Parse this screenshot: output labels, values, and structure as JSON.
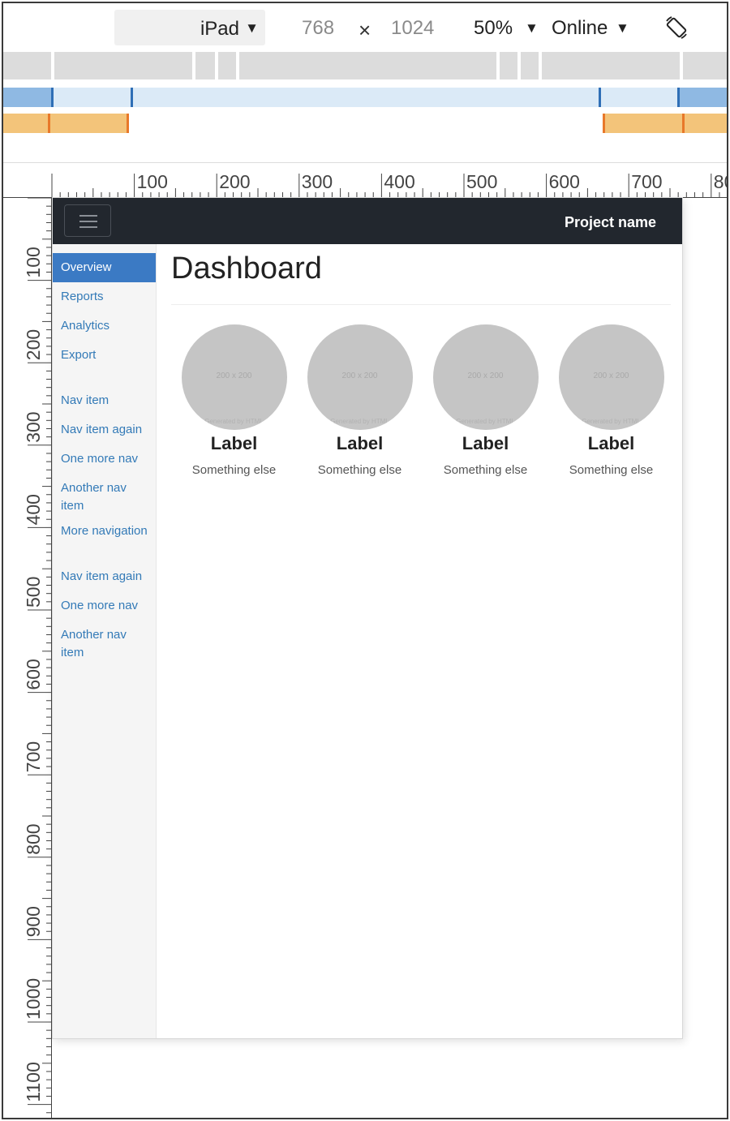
{
  "toolbar": {
    "device": "iPad",
    "width": "768",
    "times": "×",
    "height": "1024",
    "zoom": "50%",
    "network": "Online",
    "caret": "▼",
    "rotate_icon": "rotate-icon"
  },
  "ruler": {
    "top_labels": [
      "100",
      "200",
      "300",
      "400",
      "500",
      "600",
      "700",
      "80"
    ],
    "left_labels": [
      "100",
      "200",
      "300",
      "400",
      "500",
      "600",
      "700",
      "800",
      "900",
      "1000",
      "1100"
    ]
  },
  "app": {
    "brand": "Project name",
    "menu_icon": "hamburger-icon",
    "sidebar": {
      "group1": [
        "Overview",
        "Reports",
        "Analytics",
        "Export"
      ],
      "group2": [
        "Nav item",
        "Nav item again",
        "One more nav",
        "Another nav item",
        "More navigation"
      ],
      "group3": [
        "Nav item again",
        "One more nav",
        "Another nav item"
      ]
    },
    "title": "Dashboard",
    "placeholders": [
      {
        "size": "200 x 200",
        "credit": "Generated by HTML",
        "label": "Label",
        "subtext": "Something else"
      },
      {
        "size": "200 x 200",
        "credit": "Generated by HTML",
        "label": "Label",
        "subtext": "Something else"
      },
      {
        "size": "200 x 200",
        "credit": "Generated by HTML",
        "label": "Label",
        "subtext": "Something else"
      },
      {
        "size": "200 x 200",
        "credit": "Generated by HTML",
        "label": "Label",
        "subtext": "Something else"
      }
    ]
  },
  "colors": {
    "navbar": "#22272e",
    "link": "#337ab7",
    "active": "#3b7ac4",
    "mq_blue_light": "#dbeaf7",
    "mq_blue": "#8fb9e3",
    "mq_orange": "#f3c47a",
    "mq_gray": "#dcdcdc"
  }
}
